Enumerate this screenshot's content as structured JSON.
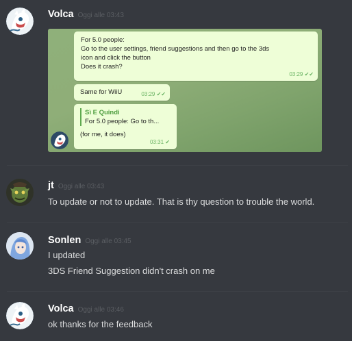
{
  "messages": [
    {
      "author": "Volca",
      "timestamp": "Oggi alle 03:43",
      "attachment": {
        "bubble1": {
          "lines": [
            "For 5.0 people:",
            "Go to the user settings, friend suggestions and then go to the 3ds",
            "icon and click the button",
            "Does it crash?"
          ],
          "time": "03:29 ✔✔"
        },
        "bubble2": {
          "text": "Same for WiiU",
          "time": "03:29 ✔✔"
        },
        "bubble3": {
          "reply_name": "Sì E Quindi",
          "reply_text": "For 5.0 people: Go to th...",
          "text": "(for me, it does)",
          "time": "03:31 ✔"
        }
      }
    },
    {
      "author": "jt",
      "timestamp": "Oggi alle 03:43",
      "lines": [
        "To update or not to update. That is thy question to trouble the world."
      ]
    },
    {
      "author": "Sonlen",
      "timestamp": "Oggi alle 03:45",
      "lines": [
        "I updated",
        "3DS Friend Suggestion didn't crash on me"
      ]
    },
    {
      "author": "Volca",
      "timestamp": "Oggi alle 03:46",
      "lines": [
        "ok thanks for the feedback"
      ]
    }
  ],
  "colors": {
    "background": "#36393f",
    "username": "#ffffff",
    "timestamp": "#5b5e63",
    "message_text": "#dcddde",
    "telegram_bubble": "#eefed7",
    "telegram_check": "#6db566"
  },
  "icons": {
    "volca_avatar": "white-creature-avatar-icon",
    "jt_avatar": "green-goblin-avatar-icon",
    "sonlen_avatar": "blue-haired-avatar-icon"
  }
}
